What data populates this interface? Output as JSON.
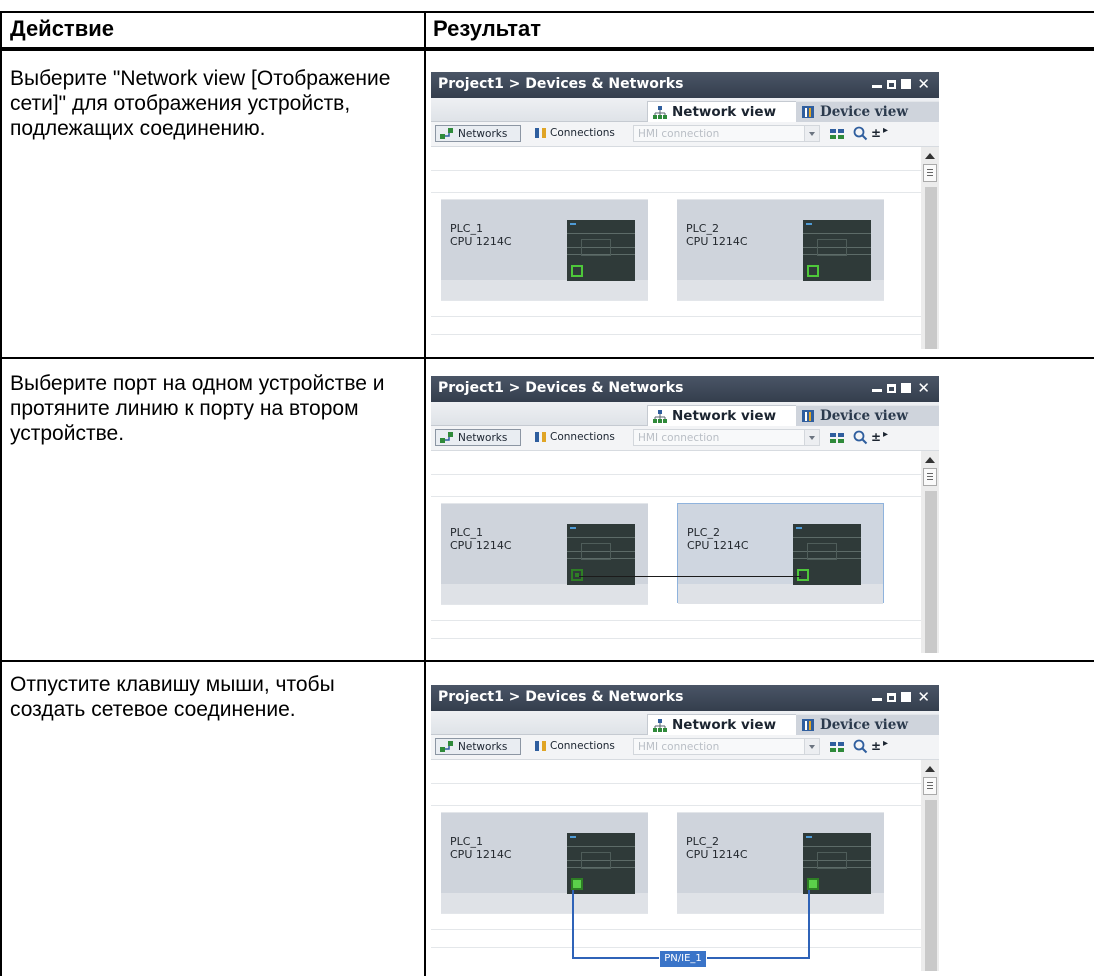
{
  "table": {
    "header": {
      "action": "Действие",
      "result": "Результат"
    },
    "rows": [
      {
        "action": "Выберите \"Network view [Отображение сети]\" для отображения устройств, подлежащих соединению."
      },
      {
        "action": "Выберите порт на одном устройстве и протяните линию к порту на втором устройстве."
      },
      {
        "action": "Отпустите клавишу мыши, чтобы создать сетевое соединение."
      }
    ]
  },
  "shot": {
    "title": "Project1 > Devices & Networks",
    "tab_network": "Network view",
    "tab_device": "Device view",
    "btn_networks": "Networks",
    "btn_connections": "Connections",
    "combo_value": "HMI connection",
    "plc1_name": "PLC_1",
    "plc1_cpu": "CPU 1214C",
    "plc2_name": "PLC_2",
    "plc2_cpu": "CPU 1214C",
    "subnet_label": "PN/IE_1",
    "zoom_label": "±"
  },
  "colors": {
    "titlebar": "#3a4454",
    "device": "#cfd4dc",
    "port": "#4ec73a",
    "subnet": "#3a74c8"
  },
  "icons": [
    "network-view-icon",
    "device-view-icon",
    "networks-icon",
    "connections-icon",
    "dropdown-icon",
    "show-addresses-icon",
    "zoom-icon",
    "minimize-icon",
    "restore-icon",
    "maximize-icon",
    "close-icon",
    "scroll-up-icon"
  ]
}
